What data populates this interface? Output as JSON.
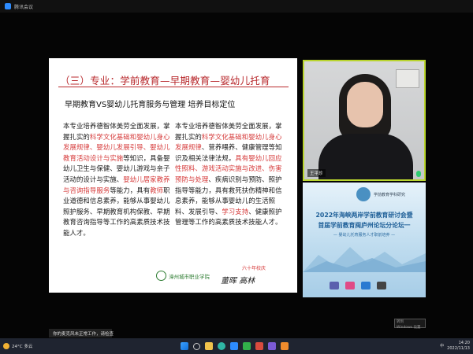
{
  "window": {
    "title": "腾讯会议"
  },
  "slide": {
    "title": "（三）专业：学前教育—早期教育—婴幼儿托育",
    "subtitle": "早期教育VS婴幼儿托育服务与管理  培养目标定位",
    "left_column": [
      {
        "t": "本专业培养德智体美劳全面发展，掌握扎实的",
        "hl": false
      },
      {
        "t": "科学文化基础和婴幼儿身心发展规律、婴幼儿发展引导、婴幼儿教育活动设计与实施",
        "hl": true
      },
      {
        "t": "等知识，具备婴幼儿卫生与保健、婴幼儿游戏与亲子活动的设计与实施、",
        "hl": false
      },
      {
        "t": "婴幼儿居家教养与咨询指导服务",
        "hl": true
      },
      {
        "t": "等能力，具有",
        "hl": false
      },
      {
        "t": "教师",
        "hl": true
      },
      {
        "t": "职业道德和信息素养，能够从事婴幼儿照护服务、早期教育机构保教、早期教育咨询指导等工作的高素质技术技能人才。",
        "hl": false
      }
    ],
    "right_column": [
      {
        "t": "本专业培养德智体美劳全面发展，掌握扎实的",
        "hl": false
      },
      {
        "t": "科学文化基础和婴幼儿身心发展规律",
        "hl": true
      },
      {
        "t": "、营养喂养、健康管理等知识及相关法律法规，",
        "hl": false
      },
      {
        "t": "具有婴幼儿回应性照料、游戏活动实施与改进、伤害预防与处理",
        "hl": true
      },
      {
        "t": "、疾病识别与预防、照护指导等能力，具有救死扶伤精神和信息素养，能够从事婴幼儿的生活照料、发展引导、",
        "hl": false
      },
      {
        "t": "学习支持",
        "hl": true
      },
      {
        "t": "、健康照护管理等工作的高素质技术技能人才。",
        "hl": false
      }
    ],
    "school_name": "漳州城市职业学院",
    "signature": "董晖 高林",
    "anniversary": "六十年校庆"
  },
  "video": {
    "name": "王平珍"
  },
  "poster": {
    "small_text": "学前教育学科研究",
    "line1": "2022年海峡两岸学前教育研讨会暨",
    "line2": "首届学前教育闽庐州论坛分论坛一",
    "line3": "— 婴幼儿托育服务人才职前培养 —"
  },
  "notification": {
    "text": "你的麦克风未正常工作，请检查"
  },
  "activation": {
    "line1": "转到",
    "line2": "Windows 设置"
  },
  "taskbar": {
    "weather": "24°C 多云",
    "tray_lang": "中",
    "time": "14:20",
    "date": "2022/11/13"
  },
  "colors": {
    "accent_red": "#d63a3a",
    "title_red": "#b8282c",
    "poster_blue": "#1d5e97",
    "highlight_frame": "#b9d42e"
  }
}
